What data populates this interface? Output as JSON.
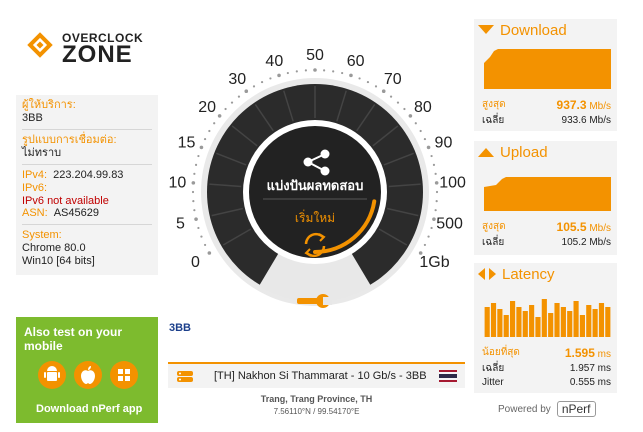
{
  "brand": {
    "line1": "OVERCLOCK",
    "line2": "ZONE"
  },
  "provider": {
    "isp_label": "ผู้ให้บริการ:",
    "isp_value": "3BB",
    "conn_label": "รูปแบบการเชื่อมต่อ:",
    "conn_value": "ไม่ทราบ",
    "ipv4_label": "IPv4:",
    "ipv4_value": "223.204.99.83",
    "ipv6_label": "IPv6:",
    "ipv6_value": "IPv6 not available",
    "asn_label": "ASN:",
    "asn_value": "AS45629",
    "system_label": "System:",
    "system_browser": "Chrome 80.0",
    "system_os": "Win10 [64 bits]"
  },
  "mobile": {
    "title": "Also test on your mobile",
    "download": "Download nPerf app",
    "icons": [
      "android-icon",
      "apple-icon",
      "windows-icon"
    ]
  },
  "gauge": {
    "ticks": [
      "0",
      "5",
      "10",
      "15",
      "20",
      "30",
      "40",
      "50",
      "60",
      "70",
      "80",
      "90",
      "100",
      "500",
      "1Gb"
    ],
    "share_label": "แบ่งปันผลทดสอบ",
    "restart_label": "เริ่มใหม่",
    "progress_fraction": 0.9
  },
  "isp_logo": "3BB",
  "server": {
    "name": "[TH] Nakhon Si Thammarat - 10 Gb/s - 3BB",
    "location": "Trang, Trang Province, TH",
    "coords": "7.56110°N / 99.54170°E"
  },
  "download": {
    "title": "Download",
    "max_label": "สูงสุด",
    "max_value": "937.3",
    "avg_label": "เฉลี่ย",
    "avg_value": "933.6 Mb/s",
    "unit": "Mb/s"
  },
  "upload": {
    "title": "Upload",
    "max_label": "สูงสุด",
    "max_value": "105.5",
    "avg_label": "เฉลี่ย",
    "avg_value": "105.2 Mb/s",
    "unit": "Mb/s"
  },
  "latency": {
    "title": "Latency",
    "min_label": "น้อยที่สุด",
    "min_value": "1.595",
    "min_unit": "ms",
    "avg_label": "เฉลี่ย",
    "avg_value": "1.957 ms",
    "jitter_label": "Jitter",
    "jitter_value": "0.555 ms"
  },
  "powered": {
    "label": "Powered by",
    "brand": "nPerf"
  },
  "colors": {
    "accent": "#f39200",
    "green": "#7dbb2e",
    "dark": "#222222",
    "panel": "#f3f3f3"
  }
}
